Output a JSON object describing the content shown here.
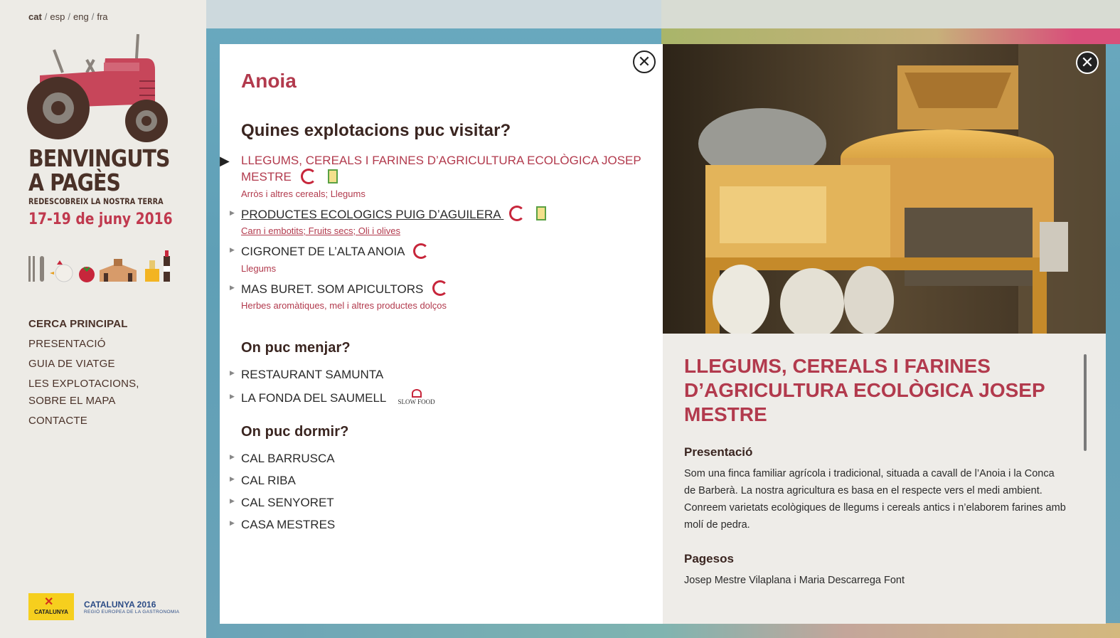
{
  "languages": [
    {
      "label": "cat",
      "active": true
    },
    {
      "label": "esp",
      "active": false
    },
    {
      "label": "eng",
      "active": false
    },
    {
      "label": "fra",
      "active": false
    }
  ],
  "logo": {
    "line1": "BENVINGUTS",
    "line2": "A PAGÈS",
    "subtitle": "REDESCOBREIX LA NOSTRA TERRA",
    "dates": "17-19 de juny 2016"
  },
  "menu": [
    {
      "label": "CERCA PRINCIPAL",
      "active": true
    },
    {
      "label": "PRESENTACIÓ",
      "active": false
    },
    {
      "label": "GUIA DE VIATGE",
      "active": false
    },
    {
      "label": "LES EXPLOTACIONS, SOBRE EL MAPA",
      "active": false
    },
    {
      "label": "CONTACTE",
      "active": false
    }
  ],
  "footer": {
    "catalunya_label": "CATALUNYA",
    "region_line1": "CATALUNYA 2016",
    "region_line2": "REGIÓ EUROPEA DE LA GASTRONOMIA"
  },
  "left_panel": {
    "region": "Anoia",
    "visit_title": "Quines explotacions puc visitar?",
    "visits": [
      {
        "name": "LLEGUMS, CEREALS I FARINES D’AGRICULTURA ECOLÒGICA JOSEP MESTRE",
        "categories": "Arròs i altres cereals; Llegums"
      },
      {
        "name": "PRODUCTES ECOLOGICS PUIG D’AGUILERA",
        "categories": "Carn i embotits; Fruits secs; Oli i olives"
      },
      {
        "name": "CIGRONET DE L’ALTA ANOIA",
        "categories": "Llegums"
      },
      {
        "name": "MAS BURET. SOM APICULTORS",
        "categories": "Herbes aromàtiques, mel i altres productes dolços"
      }
    ],
    "eat_title": "On puc menjar?",
    "eat": [
      {
        "name": "RESTAURANT SAMUNTA"
      },
      {
        "name": "LA FONDA DEL SAUMELL",
        "badge": "Slow Food"
      }
    ],
    "sleep_title": "On puc dormir?",
    "sleep": [
      {
        "name": "CAL BARRUSCA"
      },
      {
        "name": "CAL RIBA"
      },
      {
        "name": "CAL SENYORET"
      },
      {
        "name": "CASA MESTRES"
      }
    ]
  },
  "right_panel": {
    "title": "LLEGUMS, CEREALS I FARINES D’AGRICULTURA ECOLÒGICA JOSEP MESTRE",
    "presentation_heading": "Presentació",
    "presentation_text": "Som una finca familiar agrícola i tradicional, situada a cavall de l’Anoia i la Conca de Barberà. La nostra agricultura es basa en el respecte vers el medi ambient. Conreem varietats ecològiques de llegums i cereals antics i n’elaborem farines amb molí de pedra.",
    "farmers_heading": "Pagesos",
    "farmers_text": "Josep Mestre Vilaplana i Maria Descarrega Font"
  },
  "colors": {
    "accent": "#b23a4d",
    "brown": "#4a3128",
    "sidebar_bg": "#edebe6",
    "backdrop": "#6aa9bf"
  },
  "icons": {
    "close": "close-icon",
    "arrow": "triangle-right-icon"
  }
}
